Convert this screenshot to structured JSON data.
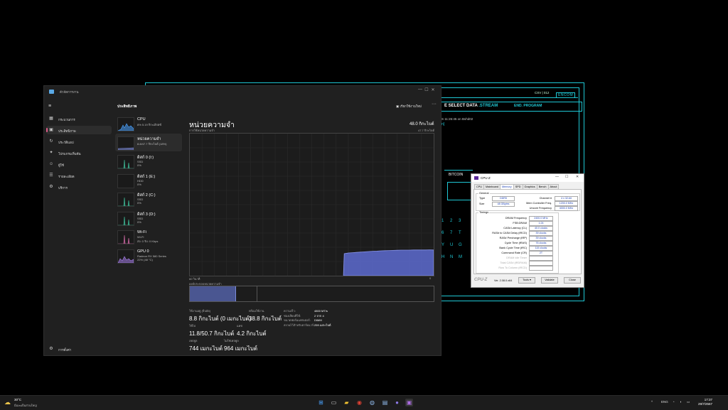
{
  "bg_app": {
    "csv": "CSV | 012",
    "logo": "ENCOM",
    "select_prefix": "E SELECT DATA",
    "select_accent": ".STREAM",
    "end": "END. PROGRAM",
    "time": "S 11:26:45 on Bvhd02",
    "glyph": "n]",
    "btc": "BITCOIN",
    "keys": [
      "1",
      "2",
      "3",
      "6",
      "7",
      "T",
      "Y",
      "U",
      "G",
      "H",
      "N",
      "M"
    ]
  },
  "taskmgr": {
    "title": "ตัวจัดการงาน",
    "window_buttons": [
      "—",
      "☐",
      "✕"
    ],
    "section": "ประสิทธิภาพ",
    "run_task": "เรียกใช้งานใหม่",
    "more": "···",
    "nav": [
      {
        "icon": "▦",
        "label": "กระบวนการ"
      },
      {
        "icon": "▣",
        "label": "ประสิทธิภาพ"
      },
      {
        "icon": "↻",
        "label": "ประวัติแอป"
      },
      {
        "icon": "✦",
        "label": "โปรแกรมเริ่มต้น"
      },
      {
        "icon": "☺",
        "label": "ผู้ใช้"
      },
      {
        "icon": "☰",
        "label": "รายละเอียด"
      },
      {
        "icon": "⚙",
        "label": "บริการ"
      }
    ],
    "settings": "การตั้งค่า",
    "resources": [
      {
        "name": "CPU",
        "s1": "8% 5.19 กิกะเฮิรตซ์",
        "s2": ""
      },
      {
        "name": "หน่วยความจำ",
        "s1": "8.8/47.7 กิกะไบต์ (18%)",
        "s2": ""
      },
      {
        "name": "ดิสก์ 0 (I:)",
        "s1": "SSD",
        "s2": "0%"
      },
      {
        "name": "ดิสก์ 1 (E:)",
        "s1": "HDD",
        "s2": "0%"
      },
      {
        "name": "ดิสก์ 2 (C:)",
        "s1": "SSD",
        "s2": "0%"
      },
      {
        "name": "ดิสก์ 3 (D:)",
        "s1": "SSD",
        "s2": "0%"
      },
      {
        "name": "Wi-Fi",
        "s1": "Wi-Fi",
        "s2": "ส่ง: 0 รับ: 0 Kbps"
      },
      {
        "name": "GPU 0",
        "s1": "Radeon RX 580 Series",
        "s2": "22% (48 °C)"
      }
    ],
    "memory": {
      "title": "หน่วยความจำ",
      "total": "48.0 กิกะไบต์",
      "usage_label": "การใช้หน่วยความจำ",
      "usage_max": "47.7 กิกะไบต์",
      "axis_left": "60 วินาที",
      "axis_right": "0",
      "composition_label": "องค์ประกอบหน่วยความจำ",
      "stats": {
        "in_use_label": "ใช้งานอยู่ (บีบอัด)",
        "in_use": "8.8 กิกะไบต์ (0 เมกะไบต์)",
        "available_label": "พร้อมใช้งาน",
        "available": "38.8 กิกะไบต์",
        "committed_label": "ใช้ไป",
        "committed": "11.8/50.7 กิกะไบต์",
        "cached_label": "แคช",
        "cached": "4.2 กิกะไบต์",
        "paged_label": "เพจพูล",
        "paged": "744 เมกะไบต์",
        "nonpaged_label": "ไม่ใช่เพจพูล",
        "nonpaged": "964 เมกะไบต์"
      },
      "spec_labels": [
        "ความเร็ว:",
        "ช่องเสียบที่ใช้:",
        "ขนาดฟอร์มแฟกเตอร์:",
        "สงวนไว้สำหรับฮาร์ดแวร์:"
      ],
      "spec_values": [
        "4800 MT/s",
        "2 จาก 4",
        "DIMM",
        "259 เมกะไบต์"
      ],
      "usage_fraction": 0.18,
      "usage_series": [
        0,
        0,
        0,
        0,
        0,
        0,
        0,
        0,
        0,
        0,
        0,
        0,
        0,
        0,
        0,
        0,
        0,
        0,
        0,
        0,
        0,
        0,
        0,
        0,
        0,
        0,
        0,
        0,
        0,
        0,
        0,
        0,
        0,
        0,
        0,
        0,
        0,
        0,
        0.155,
        0.16,
        0.162,
        0.164,
        0.166,
        0.168,
        0.17,
        0.172,
        0.173,
        0.175,
        0.176,
        0.177,
        0.178,
        0.179,
        0.18,
        0.18,
        0.18,
        0.181,
        0.181,
        0.181,
        0.181,
        0.182,
        0.181
      ]
    }
  },
  "cpuz": {
    "title": "CPU-Z",
    "window_buttons": [
      "—",
      "☐",
      "✕"
    ],
    "tabs": [
      "CPU",
      "Mainboard",
      "Memory",
      "SPD",
      "Graphics",
      "Bench",
      "About"
    ],
    "active_tab": "Memory",
    "general_label": "General",
    "type_label": "Type",
    "type": "DDR5",
    "size_label": "Size",
    "size": "48 GBytes",
    "channel_label": "Channel #",
    "channel": "4 x 32-bit",
    "mem_ctrl_label": "Mem Controller Freq.",
    "mem_ctrl": "1200.0 MHz",
    "uncore_label": "Uncore Frequency",
    "uncore": "4000.0 MHz",
    "timings_label": "Timings",
    "timings": [
      {
        "label": "DRAM Frequency",
        "value": "2400.0 MHz",
        "dim": false
      },
      {
        "label": "FSB:DRAM",
        "value": "1:24",
        "dim": false
      },
      {
        "label": "CAS# Latency (CL)",
        "value": "40.0 clocks",
        "dim": false
      },
      {
        "label": "RAS# to CAS# Delay (tRCD)",
        "value": "39 clocks",
        "dim": false
      },
      {
        "label": "RAS# Precharge (tRP)",
        "value": "39 clocks",
        "dim": false
      },
      {
        "label": "Cycle Time (tRAS)",
        "value": "76 clocks",
        "dim": false
      },
      {
        "label": "Bank Cycle Time (tRC)",
        "value": "115 clocks",
        "dim": false
      },
      {
        "label": "Command Rate (CR)",
        "value": "2T",
        "dim": false
      },
      {
        "label": "DRAM Idle Timer",
        "value": "",
        "dim": true
      },
      {
        "label": "Total CAS# (tRDRAM)",
        "value": "",
        "dim": true
      },
      {
        "label": "Row To Column (tRCD)",
        "value": "",
        "dim": true
      }
    ],
    "logo": "CPU-Z",
    "version": "Ver. 2.08.0.x64",
    "tools": "Tools",
    "validate": "Validate",
    "close": "Close"
  },
  "taskbar": {
    "temp": "30°C",
    "condition": "มีเมฆเป็นส่วนใหญ่",
    "tray_up": "^",
    "lang": "ENG",
    "time": "17:37",
    "date": "29/7/2567"
  },
  "colors": {
    "cyan": "#1fc7d4",
    "mem_fill": "#5a67c7",
    "mem_line": "#8a97ef",
    "accent_pink": "#e05d8a"
  }
}
